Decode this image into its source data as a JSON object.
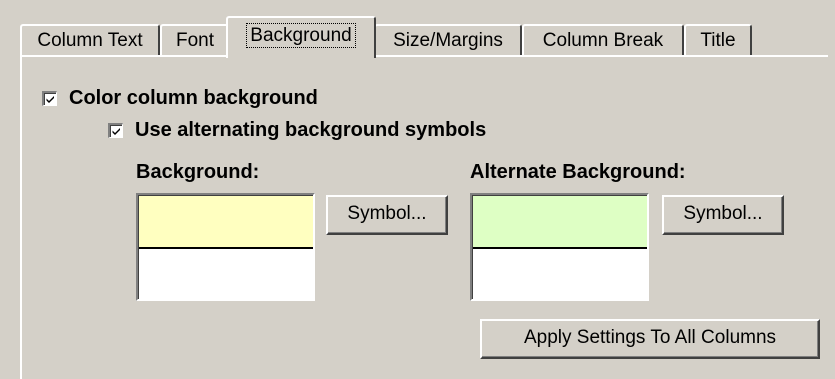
{
  "tabs": [
    {
      "label": "Column Text",
      "selected": false
    },
    {
      "label": "Font",
      "selected": false
    },
    {
      "label": "Background",
      "selected": true
    },
    {
      "label": "Size/Margins",
      "selected": false
    },
    {
      "label": "Column Break",
      "selected": false
    },
    {
      "label": "Title",
      "selected": false
    }
  ],
  "options": {
    "color_background": {
      "label": "Color column background",
      "checked": true
    },
    "alternating": {
      "label": "Use alternating background symbols",
      "checked": true
    }
  },
  "background": {
    "label": "Background:",
    "color": "#ffffc0",
    "symbol_button": "Symbol..."
  },
  "alternate": {
    "label": "Alternate Background:",
    "color": "#deffc4",
    "symbol_button": "Symbol..."
  },
  "apply_button": "Apply Settings To All Columns",
  "colors": {
    "face": "#d4d0c8",
    "highlight": "#ffffff",
    "shadow": "#808080",
    "dark_shadow": "#404040"
  }
}
